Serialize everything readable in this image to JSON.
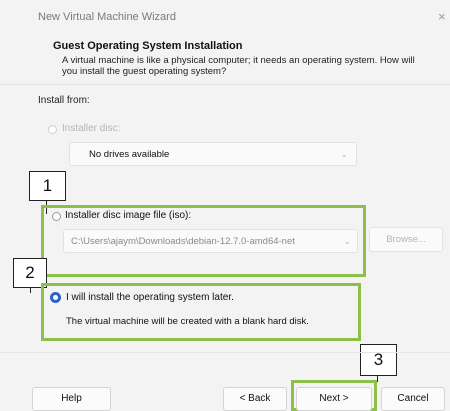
{
  "window": {
    "title": "New Virtual Machine Wizard",
    "close_glyph": "×"
  },
  "header": {
    "title": "Guest Operating System Installation",
    "description": "A virtual machine is like a physical computer; it needs an operating system. How will you install the guest operating system?"
  },
  "install_from": {
    "label": "Install from:",
    "installer_disc": {
      "label": "Installer disc:",
      "selected": false,
      "enabled": false
    },
    "disc_dropdown": {
      "value": "No drives available"
    },
    "iso_option": {
      "label": "Installer disc image file (iso):",
      "selected": false
    },
    "iso_path": {
      "value": "C:\\Users\\ajaym\\Downloads\\debian-12.7.0-amd64-net"
    },
    "browse_label": "Browse...",
    "later_option": {
      "label": "I will install the operating system later.",
      "note": "The virtual machine will be created with a blank hard disk.",
      "selected": true
    }
  },
  "annotations": {
    "callout_1": "1",
    "callout_2": "2",
    "callout_3": "3",
    "highlight_color": "#8dc04a"
  },
  "footer": {
    "help_label": "Help",
    "back_label": "< Back",
    "next_label": "Next >",
    "cancel_label": "Cancel"
  },
  "icons": {
    "dropdown_chevron": "chevron-down-icon"
  }
}
